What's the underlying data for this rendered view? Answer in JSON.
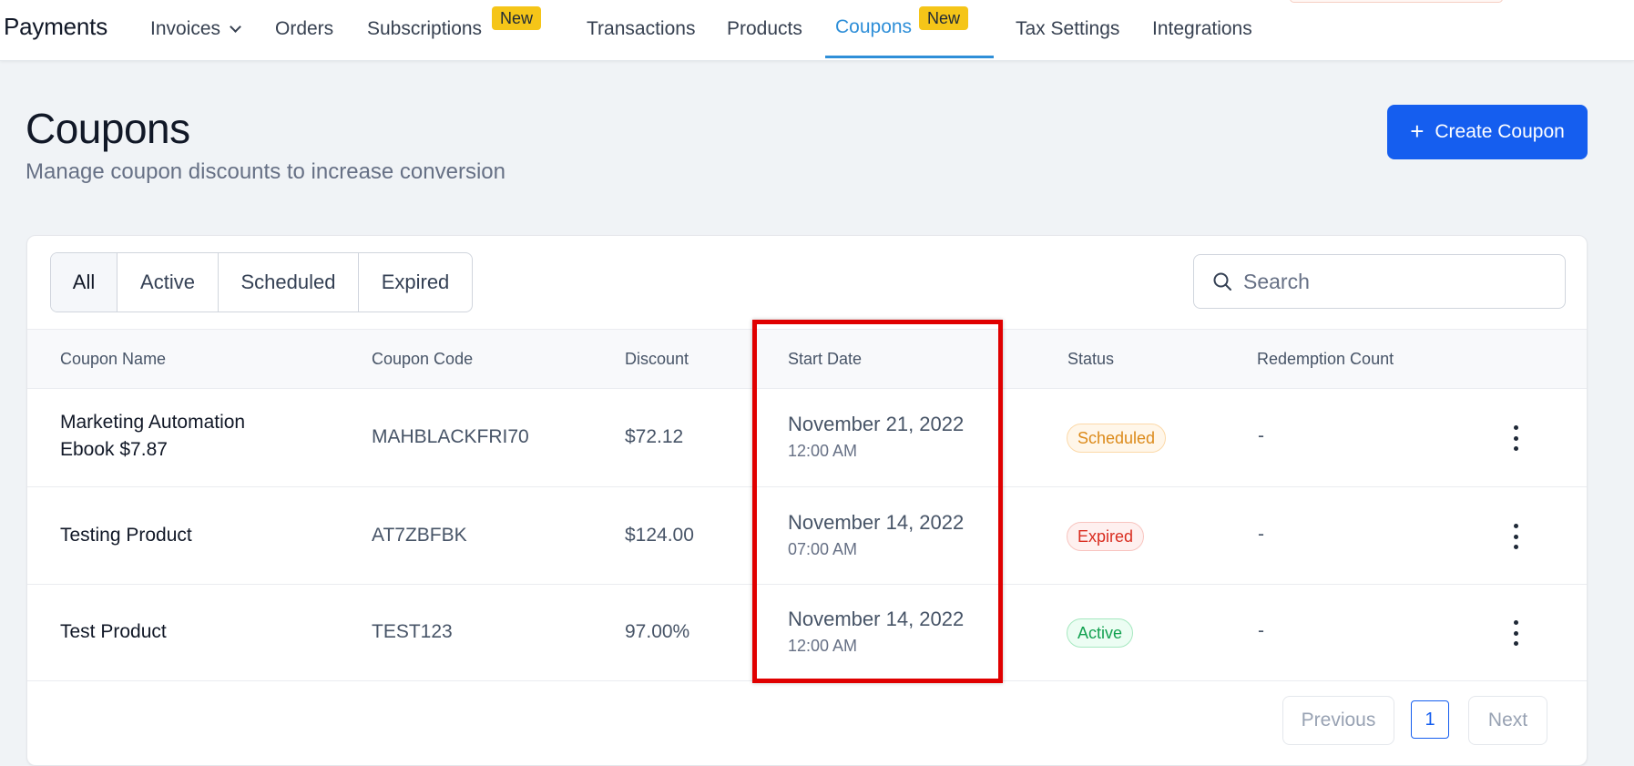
{
  "brand": "Payments",
  "nav": {
    "items": [
      {
        "label": "Invoices"
      },
      {
        "label": "Orders"
      },
      {
        "label": "Subscriptions"
      },
      {
        "label": "Transactions"
      },
      {
        "label": "Products"
      },
      {
        "label": "Coupons"
      },
      {
        "label": "Tax Settings"
      },
      {
        "label": "Integrations"
      }
    ],
    "new_badge": "New",
    "active": "Coupons"
  },
  "page": {
    "title": "Coupons",
    "subtitle": "Manage coupon discounts to increase conversion",
    "create_button": "Create Coupon"
  },
  "filters": {
    "tabs": [
      "All",
      "Active",
      "Scheduled",
      "Expired"
    ],
    "selected": "All"
  },
  "search": {
    "placeholder": "Search",
    "value": ""
  },
  "table": {
    "columns": [
      "Coupon Name",
      "Coupon Code",
      "Discount",
      "Start Date",
      "Status",
      "Redemption Count"
    ],
    "rows": [
      {
        "name_line1": "Marketing Automation",
        "name_line2": "Ebook $7.87",
        "code": "MAHBLACKFRI70",
        "discount": "$72.12",
        "start_date": "November 21, 2022",
        "start_time": "12:00 AM",
        "status": "Scheduled",
        "redemptions": "-"
      },
      {
        "name_line1": "Testing Product",
        "code": "AT7ZBFBK",
        "discount": "$124.00",
        "start_date": "November 14, 2022",
        "start_time": "07:00 AM",
        "status": "Expired",
        "redemptions": "-"
      },
      {
        "name_line1": "Test Product",
        "code": "TEST123",
        "discount": "97.00%",
        "start_date": "November 14, 2022",
        "start_time": "12:00 AM",
        "status": "Active",
        "redemptions": "-"
      }
    ]
  },
  "pagination": {
    "previous": "Previous",
    "page": "1",
    "next": "Next"
  },
  "colors": {
    "accent": "#155eef",
    "nav_active": "#2f8fd8",
    "highlight": "#e00000",
    "status_scheduled": "#dc8a1a",
    "status_expired": "#d92d20",
    "status_active": "#12a150"
  },
  "icons": {
    "invoices_dropdown": "chevron-down-icon",
    "create": "plus-icon",
    "search": "search-icon",
    "row_menu": "kebab-menu-icon"
  }
}
